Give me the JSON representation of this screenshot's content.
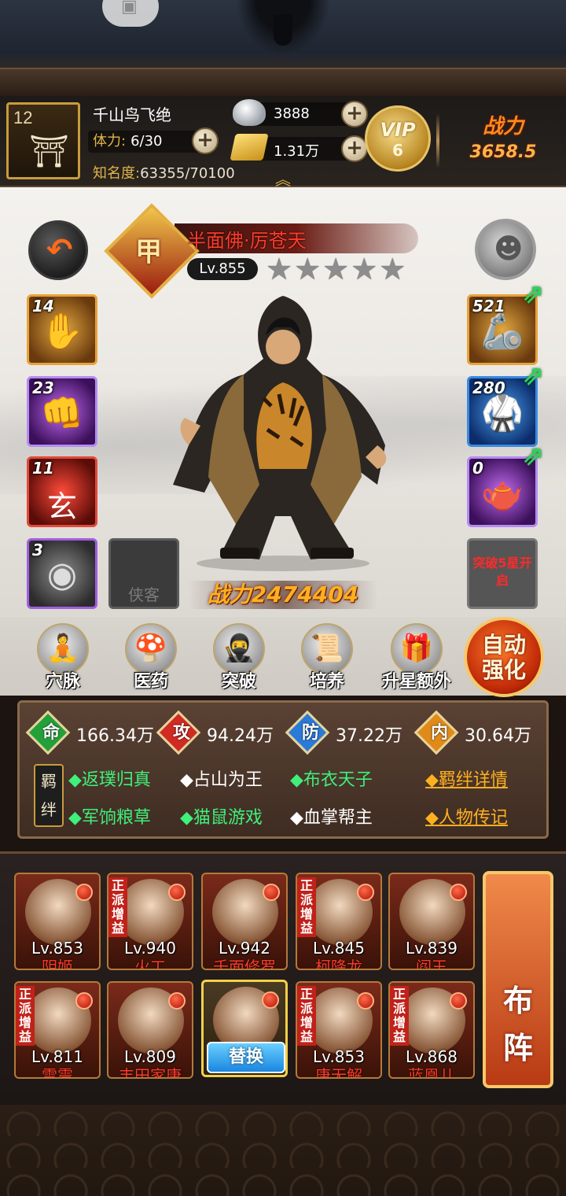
{
  "player": {
    "level": "12",
    "name": "千山鸟飞绝",
    "stamina_label": "体力:",
    "stamina_value": "6/30",
    "fame_label": "知名度:",
    "fame_value": "63355/70100",
    "silver": "3888",
    "gold": "1.31万",
    "vip_label": "VIP",
    "vip_level": "6",
    "power_label": "战力",
    "power_value": "3658.5"
  },
  "hero": {
    "name": "半面佛·厉苍天",
    "rank_char": "甲",
    "level": "Lv.855",
    "stars": "★★★★★",
    "power_text": "战力2474404",
    "left_slots": [
      {
        "count": "14",
        "icon": "palm-skill-icon",
        "glyph": "✋"
      },
      {
        "count": "23",
        "icon": "fist-skill-icon",
        "glyph": "👊"
      },
      {
        "count": "11",
        "icon": "mystic-skill-icon",
        "glyph": "玄"
      },
      {
        "count": "3",
        "icon": "token-skill-icon",
        "glyph": "◉"
      }
    ],
    "helper_slot_caption": "侠客",
    "right_slots": [
      {
        "count": "521",
        "icon": "gauntlet-icon",
        "glyph": "🦾"
      },
      {
        "count": "280",
        "icon": "robe-icon",
        "glyph": "🥋"
      },
      {
        "count": "0",
        "icon": "teapot-icon",
        "glyph": "🫖"
      }
    ],
    "locked_slot_text": "突破5星开启"
  },
  "actions": [
    {
      "label": "穴脉",
      "icon": "meridian-icon",
      "glyph": "🧘"
    },
    {
      "label": "医药",
      "icon": "medicine-icon",
      "glyph": "🍄"
    },
    {
      "label": "突破",
      "icon": "breakthrough-icon",
      "glyph": "🥷"
    },
    {
      "label": "培养",
      "icon": "scroll-icon",
      "glyph": "📜"
    },
    {
      "label": "升星额外",
      "icon": "treasure-icon",
      "glyph": "🎁"
    }
  ],
  "auto_strengthen": {
    "line1": "自动",
    "line2": "强化"
  },
  "attributes": [
    {
      "gem": "命",
      "value": "166.34万"
    },
    {
      "gem": "攻",
      "value": "94.24万"
    },
    {
      "gem": "防",
      "value": "37.22万"
    },
    {
      "gem": "内",
      "value": "30.64万"
    }
  ],
  "bond_tag": "羁绊",
  "bonds": [
    {
      "text": "◆返璞归真",
      "active": true
    },
    {
      "text": "◆占山为王",
      "active": false
    },
    {
      "text": "◆布衣天子",
      "active": true
    },
    {
      "text": "◆军饷粮草",
      "active": true
    },
    {
      "text": "◆猫鼠游戏",
      "active": true
    },
    {
      "text": "◆血掌帮主",
      "active": false
    }
  ],
  "bond_links": {
    "detail": "◆羁绊详情",
    "bio": "◆人物传记"
  },
  "roster_tag": "正派增益",
  "roster": [
    {
      "level": "Lv.853",
      "name": "阴姬",
      "tag": false
    },
    {
      "level": "Lv.940",
      "name": "火工",
      "tag": true
    },
    {
      "level": "Lv.942",
      "name": "千面修罗",
      "tag": false
    },
    {
      "level": "Lv.845",
      "name": "柯降龙",
      "tag": true
    },
    {
      "level": "Lv.839",
      "name": "阎王",
      "tag": false
    },
    {
      "level": "Lv.811",
      "name": "雷震",
      "tag": true
    },
    {
      "level": "Lv.809",
      "name": "丰田家康",
      "tag": false
    },
    {
      "selected": true,
      "replace_label": "替换"
    },
    {
      "level": "Lv.853",
      "name": "唐无解",
      "tag": true
    },
    {
      "level": "Lv.868",
      "name": "蓝凰儿",
      "tag": true
    }
  ],
  "formation": {
    "line1": "布",
    "line2": "阵"
  }
}
